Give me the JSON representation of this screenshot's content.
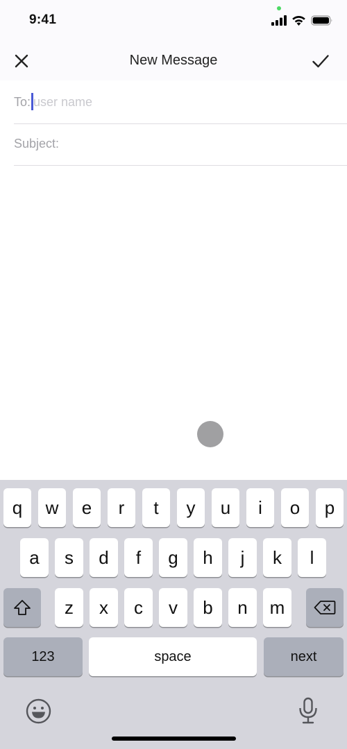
{
  "status_bar": {
    "time": "9:41",
    "icons": [
      "cellular-signal-icon",
      "wifi-icon",
      "battery-icon"
    ],
    "privacy_indicator_color": "#4cd964"
  },
  "nav_bar": {
    "title": "New Message",
    "left_icon": "close-icon",
    "right_icon": "checkmark-icon"
  },
  "form": {
    "to": {
      "label": "To:",
      "value": "",
      "placeholder": "user name"
    },
    "subject": {
      "label": "Subject:",
      "value": "",
      "placeholder": ""
    },
    "caret_color": "#4a5ad6"
  },
  "keyboard": {
    "row1": [
      "q",
      "w",
      "e",
      "r",
      "t",
      "y",
      "u",
      "i",
      "o",
      "p"
    ],
    "row2": [
      "a",
      "s",
      "d",
      "f",
      "g",
      "h",
      "j",
      "k",
      "l"
    ],
    "row3": [
      "z",
      "x",
      "c",
      "v",
      "b",
      "n",
      "m"
    ],
    "shift_icon": "shift-icon",
    "delete_icon": "backspace-icon",
    "numbers_label": "123",
    "space_label": "space",
    "return_label": "next",
    "emoji_icon": "emoji-icon",
    "dictation_icon": "microphone-icon"
  }
}
